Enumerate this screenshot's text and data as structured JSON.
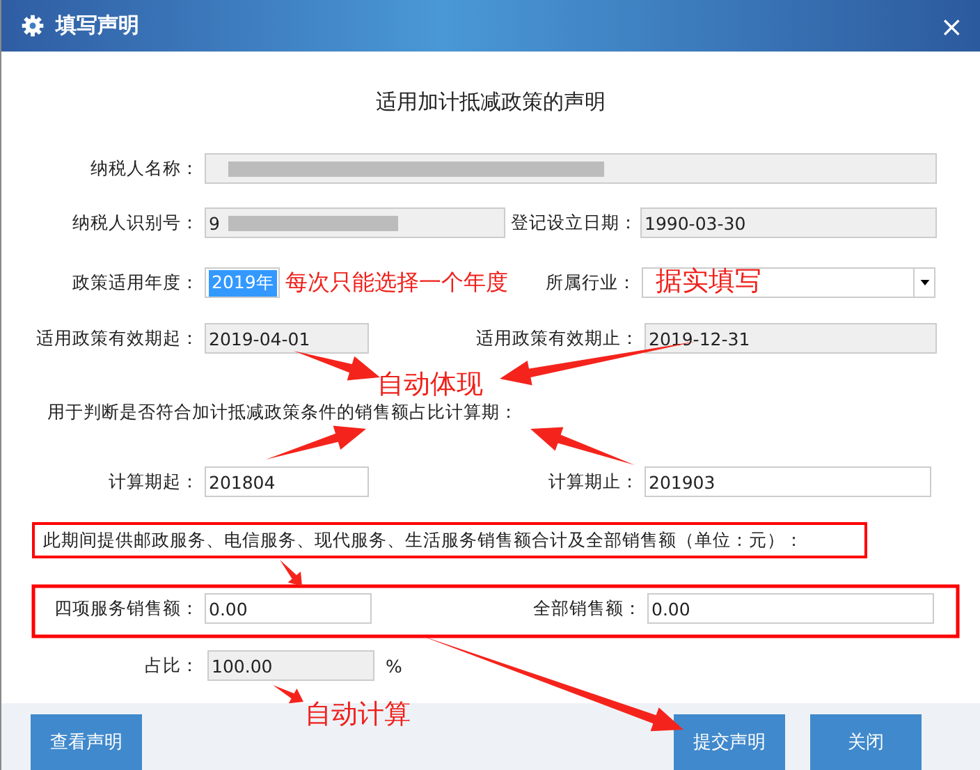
{
  "window": {
    "title": "填写声明",
    "close": "×"
  },
  "heading": "适用加计抵减政策的声明",
  "taxpayer_name": {
    "label": "纳税人名称：",
    "redacted": true,
    "readonly": true
  },
  "taxpayer_id": {
    "label": "纳税人识别号：",
    "value": "9",
    "redacted": true,
    "readonly": true
  },
  "registration_date": {
    "label": "登记设立日期：",
    "value": "1990-03-30",
    "readonly": true
  },
  "policy_year": {
    "label": "政策适用年度：",
    "value": "2019年",
    "highlighted": true
  },
  "industry": {
    "label": "所属行业："
  },
  "valid_from": {
    "label": "适用政策有效期起：",
    "value": "2019-04-01",
    "readonly": true
  },
  "valid_to": {
    "label": "适用政策有效期止：",
    "value": "2019-12-31",
    "readonly": true
  },
  "period_note": "用于判断是否符合加计抵减政策条件的销售额占比计算期：",
  "calc_start": {
    "label": "计算期起：",
    "value": "201804",
    "readonly": false
  },
  "calc_end": {
    "label": "计算期止：",
    "value": "201903",
    "readonly": false
  },
  "sales_note": "此期间提供邮政服务、电信服务、现代服务、生活服务销售额合计及全部销售额（单位：元）：",
  "four_services": {
    "label": "四项服务销售额：",
    "value": "0.00",
    "readonly": false
  },
  "total_sales": {
    "label": "全部销售额：",
    "value": "0.00",
    "readonly": false
  },
  "ratio": {
    "label": "占比：",
    "value": "100.00",
    "unit": "%",
    "readonly": true
  },
  "buttons": [
    {
      "label": "查看声明"
    },
    {
      "label": "提交声明"
    },
    {
      "label": "关闭"
    }
  ],
  "annotations": [
    {
      "text": "每次只能选择一个年度"
    },
    {
      "text": "据实填写"
    },
    {
      "text": "自动体现"
    },
    {
      "text": "自动计算"
    }
  ]
}
